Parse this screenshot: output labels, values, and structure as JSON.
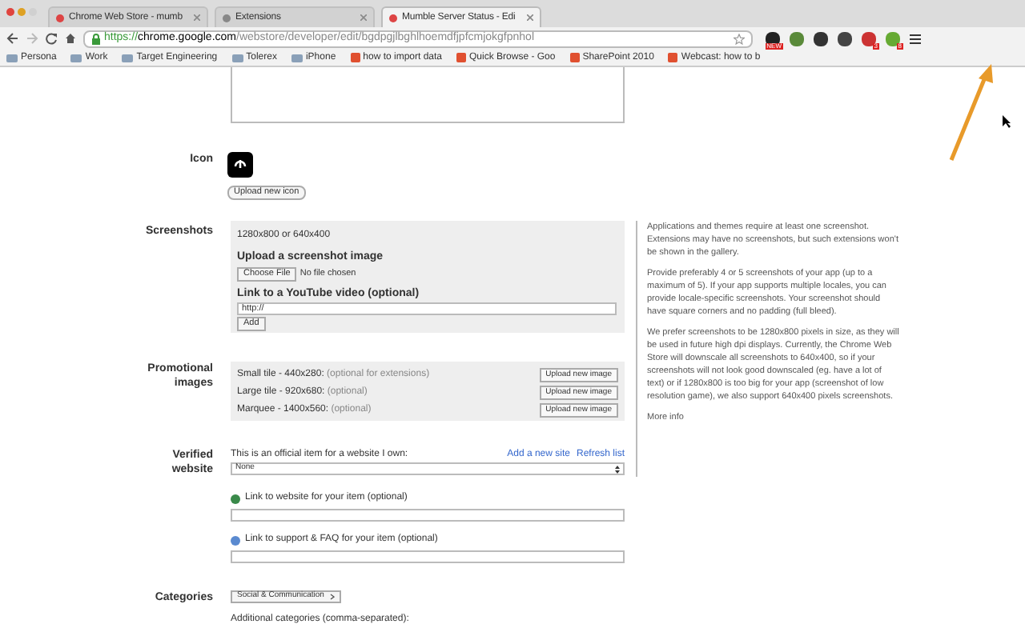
{
  "tabs": [
    {
      "title": "Chrome Web Store - mumb",
      "selected": false
    },
    {
      "title": "Extensions",
      "selected": false
    },
    {
      "title": "Mumble Server Status - Edi",
      "selected": true
    }
  ],
  "url": {
    "scheme": "https://",
    "host": "chrome.google.com",
    "path": "/webstore/developer/edit/bgdpgjlbghlhoemdfjpfcmjokgfpnhol"
  },
  "extensions": [
    {
      "kind": "badged",
      "badge": "NEW"
    },
    {
      "kind": "plain"
    },
    {
      "kind": "plain"
    },
    {
      "kind": "plain"
    },
    {
      "kind": "badged",
      "badge": "3"
    },
    {
      "kind": "badged",
      "badge": "8"
    }
  ],
  "bookmarks": [
    {
      "label": "Persona",
      "kind": "folder"
    },
    {
      "label": "Work",
      "kind": "folder"
    },
    {
      "label": "Target Engineering",
      "kind": "folder"
    },
    {
      "label": "Tolerex",
      "kind": "folder"
    },
    {
      "label": "iPhone",
      "kind": "folder"
    },
    {
      "label": "how to import data",
      "kind": "page"
    },
    {
      "label": "Quick Browse - Goo",
      "kind": "page"
    },
    {
      "label": "SharePoint 2010",
      "kind": "page"
    },
    {
      "label": "Webcast: how to b",
      "kind": "page"
    }
  ],
  "icon_section": {
    "label": "Icon",
    "button": "Upload new icon"
  },
  "screenshots": {
    "label": "Screenshots",
    "size_hint": "1280x800 or 640x400",
    "upload_heading": "Upload a screenshot image",
    "file_button": "Choose File",
    "file_status": "No file chosen",
    "video_heading": "Link to a YouTube video (optional)",
    "video_value": "http://",
    "add_button": "Add"
  },
  "help": [
    "Applications and themes require at least one screenshot. Extensions may have no screenshots, but such extensions won't be shown in the gallery.",
    "Provide preferably 4 or 5 screenshots of your app (up to a maximum of 5). If your app supports multiple locales, you can provide locale-specific screenshots. Your screenshot should have square corners and no padding (full bleed).",
    "We prefer screenshots to be 1280x800 pixels in size, as they will be used in future high dpi displays. Currently, the Chrome Web Store will downscale all screenshots to 640x400, so if your screenshots will not look good downscaled (eg. have a lot of text) or if 1280x800 is too big for your app (screenshot of low resolution game), we also support 640x400 pixels screenshots."
  ],
  "help_link": "More info",
  "promo": {
    "label": "Promotional images",
    "tiles": [
      {
        "name": "Small tile - 440x280:",
        "note": "(optional for extensions)",
        "button": "Upload new image"
      },
      {
        "name": "Large tile - 920x680:",
        "note": "(optional)",
        "button": "Upload new image"
      },
      {
        "name": "Marquee - 1400x560:",
        "note": "(optional)",
        "button": "Upload new image"
      }
    ]
  },
  "verified": {
    "label": "Verified website",
    "text": "This is an official item for a website I own:",
    "links": [
      "Add a new site",
      "Refresh list"
    ],
    "select": "None"
  },
  "links": [
    {
      "kind": "website",
      "label": "Link to website for your item (optional)"
    },
    {
      "kind": "support",
      "label": "Link to support & FAQ for your item (optional)"
    }
  ],
  "categories": {
    "label": "Categories",
    "select": "Social & Communication",
    "additional": "Additional categories (comma-separated):"
  }
}
